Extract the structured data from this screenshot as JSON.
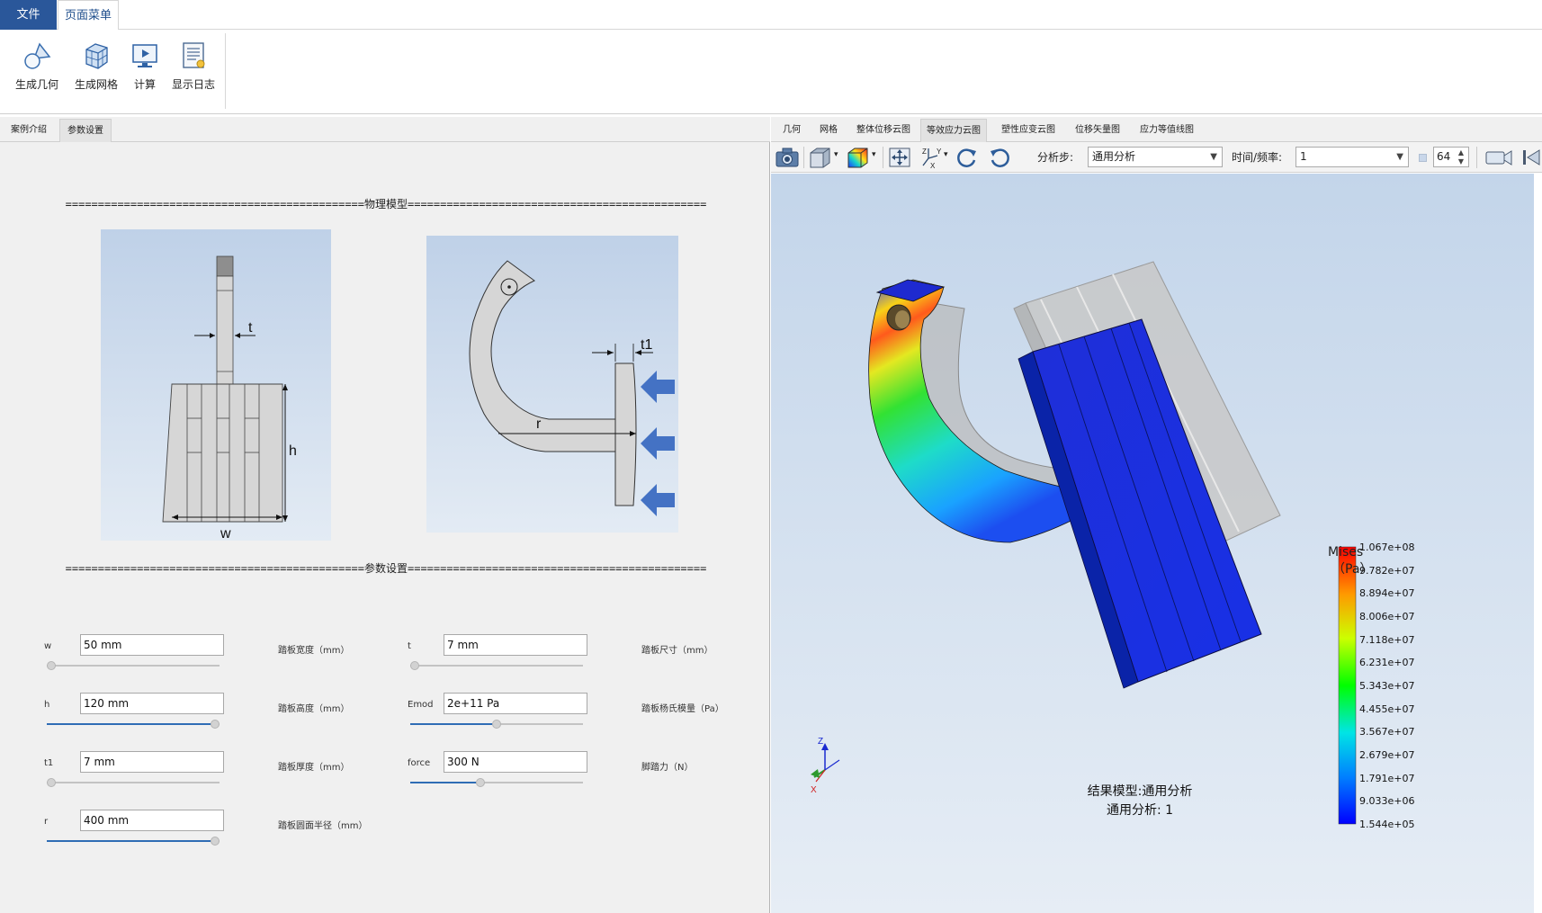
{
  "ribbon": {
    "tabs": [
      "文件",
      "页面菜单"
    ],
    "buttons": [
      "生成几何",
      "生成网格",
      "计算",
      "显示日志"
    ]
  },
  "left": {
    "tabs": [
      "案例介绍",
      "参数设置"
    ],
    "section_model": "==============================================物理模型==============================================",
    "section_params": "==============================================参数设置==============================================",
    "fig1_labels": {
      "t": "t",
      "h": "h",
      "w": "w"
    },
    "fig2_labels": {
      "t1": "t1",
      "r": "r"
    },
    "params": [
      {
        "name": "w",
        "value": "50 mm",
        "desc": "踏板宽度（mm）",
        "slider": 0.0
      },
      {
        "name": "t",
        "value": "7 mm",
        "desc": "踏板尺寸（mm）",
        "slider": 0.0
      },
      {
        "name": "h",
        "value": "120 mm",
        "desc": "踏板高度（mm）",
        "slider": 1.0
      },
      {
        "name": "Emod",
        "value": "2e+11 Pa",
        "desc": "踏板杨氏模量（Pa）",
        "slider": 0.5
      },
      {
        "name": "t1",
        "value": "7 mm",
        "desc": "踏板厚度（mm）",
        "slider": 0.0
      },
      {
        "name": "force",
        "value": "300 N",
        "desc": "脚踏力（N）",
        "slider": 0.4
      },
      {
        "name": "r",
        "value": "400 mm",
        "desc": "踏板圆面半径（mm）",
        "slider": 1.0
      }
    ]
  },
  "viewer": {
    "tabs": [
      "几何",
      "网格",
      "整体位移云图",
      "等效应力云图",
      "塑性应变云图",
      "位移矢量图",
      "应力等值线图"
    ],
    "active_tab": "等效应力云图",
    "toolbar": {
      "step_label": "分析步:",
      "step_value": "通用分析",
      "time_label": "时间/频率:",
      "time_value": "1",
      "frames": "64"
    },
    "legend": {
      "title": "Mises",
      "unit": "（Pa）",
      "values": [
        "1.067e+08",
        "9.782e+07",
        "8.894e+07",
        "8.006e+07",
        "7.118e+07",
        "6.231e+07",
        "5.343e+07",
        "4.455e+07",
        "3.567e+07",
        "2.679e+07",
        "1.791e+07",
        "9.033e+06",
        "1.544e+05"
      ]
    },
    "result_line1": "结果模型:通用分析",
    "result_line2": "通用分析: 1",
    "axes": {
      "z": "Z",
      "x": "X"
    },
    "colors": {
      "accent": "#2a579a",
      "max": "#ff0000",
      "min": "#0000ff"
    }
  }
}
